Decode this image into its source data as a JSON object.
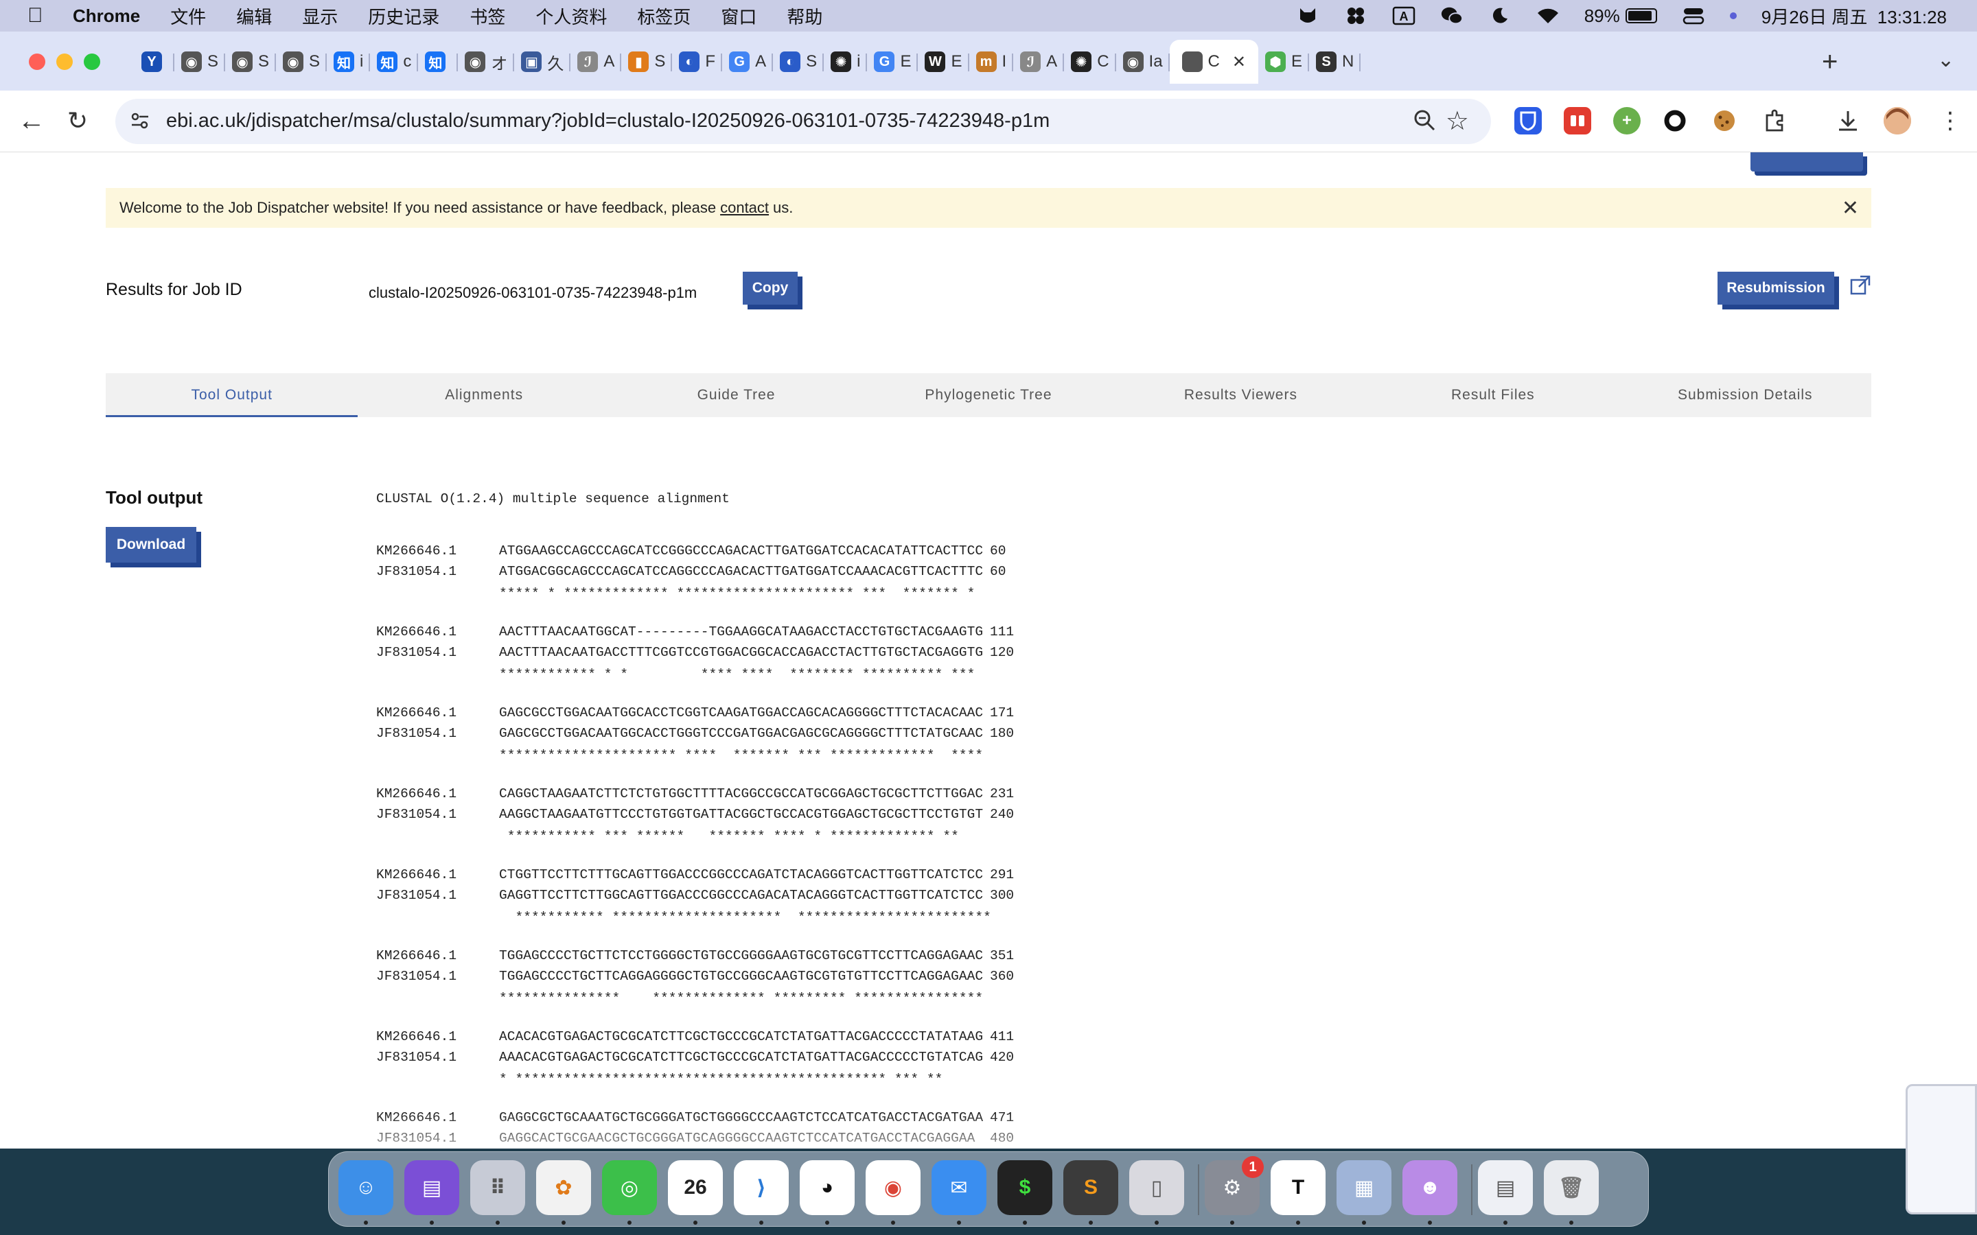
{
  "menubar": {
    "app": "Chrome",
    "items": [
      "文件",
      "编辑",
      "显示",
      "历史记录",
      "书签",
      "个人资料",
      "标签页",
      "窗口",
      "帮助"
    ],
    "battery_percent": "89%",
    "battery_level": 0.89,
    "datetime": "9月26日 周五  13:31:28"
  },
  "browser": {
    "tabs": [
      {
        "icon": "Y",
        "label": "",
        "color": "#1a4fb5"
      },
      {
        "icon": "◉",
        "label": "S",
        "color": "#555"
      },
      {
        "icon": "◉",
        "label": "S",
        "color": "#555"
      },
      {
        "icon": "◉",
        "label": "S",
        "color": "#555"
      },
      {
        "icon": "知",
        "label": "i",
        "color": "#1772f6"
      },
      {
        "icon": "知",
        "label": "c",
        "color": "#1772f6"
      },
      {
        "icon": "知",
        "label": "",
        "color": "#1772f6"
      },
      {
        "icon": "◉",
        "label": "オ",
        "color": "#555"
      },
      {
        "icon": "▣",
        "label": "久",
        "color": "#3a5a9a"
      },
      {
        "icon": "ℐ",
        "label": "A",
        "color": "#888"
      },
      {
        "icon": "▮",
        "label": "S",
        "color": "#e07b1a"
      },
      {
        "icon": "◐",
        "label": "F",
        "color": "#2a5cc9"
      },
      {
        "icon": "G",
        "label": "A",
        "color": "#4285f4"
      },
      {
        "icon": "◐",
        "label": "S",
        "color": "#2a5cc9"
      },
      {
        "icon": "✺",
        "label": "i",
        "color": "#222"
      },
      {
        "icon": "G",
        "label": "E",
        "color": "#4285f4"
      },
      {
        "icon": "W",
        "label": "E",
        "color": "#222"
      },
      {
        "icon": "m",
        "label": "I",
        "color": "#c57a2a"
      },
      {
        "icon": "ℐ",
        "label": "A",
        "color": "#888"
      },
      {
        "icon": "✺",
        "label": "C",
        "color": "#222"
      },
      {
        "icon": "◉",
        "label": "Ia",
        "color": "#555"
      },
      {
        "icon": "",
        "label": "C",
        "color": "#555"
      },
      {
        "icon": "⬢",
        "label": "E",
        "color": "#4caf50"
      },
      {
        "icon": "S",
        "label": "N",
        "color": "#333"
      }
    ],
    "active_tab_index": 21,
    "url": "ebi.ac.uk/jdispatcher/msa/clustalo/summary?jobId=clustalo-I20250926-063101-0735-74223948-p1m"
  },
  "page": {
    "banner": {
      "text_before": "Welcome to the Job Dispatcher website! If you need assistance or have feedback, please",
      "link": "contact",
      "text_after": "us."
    },
    "job": {
      "label": "Results for Job ID",
      "id": "clustalo-I20250926-063101-0735-74223948-p1m",
      "copy_label": "Copy",
      "resubmit_label": "Resubmission"
    },
    "tabs": [
      "Tool Output",
      "Alignments",
      "Guide Tree",
      "Phylogenetic Tree",
      "Results Viewers",
      "Result Files",
      "Submission Details"
    ],
    "active_tab": 0,
    "section_title": "Tool output",
    "download_label": "Download",
    "alignment": {
      "header": "CLUSTAL O(1.2.4) multiple sequence alignment",
      "blocks": [
        {
          "rows": [
            {
              "id": "KM266646.1",
              "seq": "ATGGAAGCCAGCCCAGCATCCGGGCCCAGACACTTGATGGATCCACACATATTCACTTCC",
              "pos": "60"
            },
            {
              "id": "JF831054.1",
              "seq": "ATGGACGGCAGCCCAGCATCCAGGCCCAGACACTTGATGGATCCAAACACGTTCACTTTC",
              "pos": "60"
            }
          ],
          "cons": "***** * ************* ********************** ***  ******* *"
        },
        {
          "rows": [
            {
              "id": "KM266646.1",
              "seq": "AACTTTAACAATGGCAT---------TGGAAGGCATAAGACCTACCTGTGCTACGAAGTG",
              "pos": "111"
            },
            {
              "id": "JF831054.1",
              "seq": "AACTTTAACAATGACCTTTCGGTCCGTGGACGGCACCAGACCTACTTGTGCTACGAGGTG",
              "pos": "120"
            }
          ],
          "cons": "************ * *         **** ****  ******** ********** ***"
        },
        {
          "rows": [
            {
              "id": "KM266646.1",
              "seq": "GAGCGCCTGGACAATGGCACCTCGGTCAAGATGGACCAGCACAGGGGCTTTCTACACAAC",
              "pos": "171"
            },
            {
              "id": "JF831054.1",
              "seq": "GAGCGCCTGGACAATGGCACCTGGGTCCCGATGGACGAGCGCAGGGGCTTTCTATGCAAC",
              "pos": "180"
            }
          ],
          "cons": "********************** ****  ******* *** *************  ****"
        },
        {
          "rows": [
            {
              "id": "KM266646.1",
              "seq": "CAGGCTAAGAATCTTCTCTGTGGCTTTTACGGCCGCCATGCGGAGCTGCGCTTCTTGGAC",
              "pos": "231"
            },
            {
              "id": "JF831054.1",
              "seq": "AAGGCTAAGAATGTTCCCTGTGGTGATTACGGCTGCCACGTGGAGCTGCGCTTCCTGTGT",
              "pos": "240"
            }
          ],
          "cons": " *********** *** ******   ******* **** * ************* **"
        },
        {
          "rows": [
            {
              "id": "KM266646.1",
              "seq": "CTGGTTCCTTCTTTGCAGTTGGACCCGGCCCAGATCTACAGGGTCACTTGGTTCATCTCC",
              "pos": "291"
            },
            {
              "id": "JF831054.1",
              "seq": "GAGGTTCCTTCTTGGCAGTTGGACCCGGCCCAGACATACAGGGTCACTTGGTTCATCTCC",
              "pos": "300"
            }
          ],
          "cons": "  *********** *********************  ************************"
        },
        {
          "rows": [
            {
              "id": "KM266646.1",
              "seq": "TGGAGCCCCTGCTTCTCCTGGGGCTGTGCCGGGGAAGTGCGTGCGTTCCTTCAGGAGAAC",
              "pos": "351"
            },
            {
              "id": "JF831054.1",
              "seq": "TGGAGCCCCTGCTTCAGGAGGGGCTGTGCCGGGCAAGTGCGTGTGTTCCTTCAGGAGAAC",
              "pos": "360"
            }
          ],
          "cons": "***************    ************** ********* ****************"
        },
        {
          "rows": [
            {
              "id": "KM266646.1",
              "seq": "ACACACGTGAGACTGCGCATCTTCGCTGCCCGCATCTATGATTACGACCCCCTATATAAG",
              "pos": "411"
            },
            {
              "id": "JF831054.1",
              "seq": "AAACACGTGAGACTGCGCATCTTCGCTGCCCGCATCTATGATTACGACCCCCTGTATCAG",
              "pos": "420"
            }
          ],
          "cons": "* ********************************************** *** **"
        },
        {
          "rows": [
            {
              "id": "KM266646.1",
              "seq": "GAGGCGCTGCAAATGCTGCGGGATGCTGGGGCCCAAGTCTCCATCATGACCTACGATGAA",
              "pos": "471"
            },
            {
              "id": "JF831054.1",
              "seq": "GAGGCACTGCGAACGCTGCGGGATGCAGGGGCCAAGTCTCCATCATGACCTACGAGGAA",
              "pos": "480"
            }
          ],
          "cons": ""
        }
      ]
    }
  }
}
